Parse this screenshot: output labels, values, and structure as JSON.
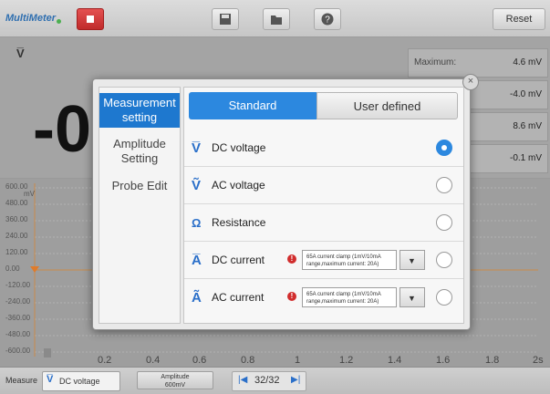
{
  "toolbar": {
    "app_title": "MultiMeter",
    "reset_label": "Reset",
    "icons": [
      "stop-icon",
      "save-icon",
      "folder-icon",
      "help-icon"
    ]
  },
  "meter": {
    "mode_symbol": "V̅",
    "reading": "-0",
    "stats": [
      {
        "label": "Maximum:",
        "value": "4.6 mV"
      },
      {
        "label": "",
        "value": "-4.0 mV"
      },
      {
        "label": "",
        "value": "8.6 mV"
      },
      {
        "label": "",
        "value": "-0.1 mV"
      }
    ]
  },
  "graph": {
    "y_unit": "mV",
    "y_ticks": [
      "600.00",
      "480.00",
      "360.00",
      "240.00",
      "120.00",
      "0.00",
      "-120.00",
      "-240.00",
      "-360.00",
      "-480.00",
      "-600.00"
    ],
    "x_ticks": [
      "0.2",
      "0.4",
      "0.6",
      "0.8",
      "1",
      "1.2",
      "1.4",
      "1.6",
      "1.8",
      "2s"
    ]
  },
  "bottom": {
    "measure_label": "Measure",
    "measure_value": "DC voltage",
    "amplitude_line1": "Amplitude",
    "amplitude_line2": "600mV",
    "page": "32/32"
  },
  "dialog": {
    "sidebar": [
      {
        "label": "Measurement setting",
        "active": true
      },
      {
        "label": "Amplitude Setting",
        "active": false
      },
      {
        "label": "Probe Edit",
        "active": false
      }
    ],
    "tabs": {
      "standard": "Standard",
      "user_defined": "User defined"
    },
    "options": [
      {
        "icon": "V̅",
        "label": "DC voltage",
        "selected": true
      },
      {
        "icon": "Ṽ",
        "label": "AC voltage",
        "selected": false
      },
      {
        "icon": "Ω",
        "label": "Resistance",
        "selected": false
      },
      {
        "icon": "A̅",
        "label": "DC current",
        "selected": false,
        "clamp": "65A current clamp (1mV/10mA range,maximum current: 20A)"
      },
      {
        "icon": "Ã",
        "label": "AC current",
        "selected": false,
        "clamp": "65A current clamp (1mV/10mA range,maximum current: 20A)"
      }
    ]
  }
}
